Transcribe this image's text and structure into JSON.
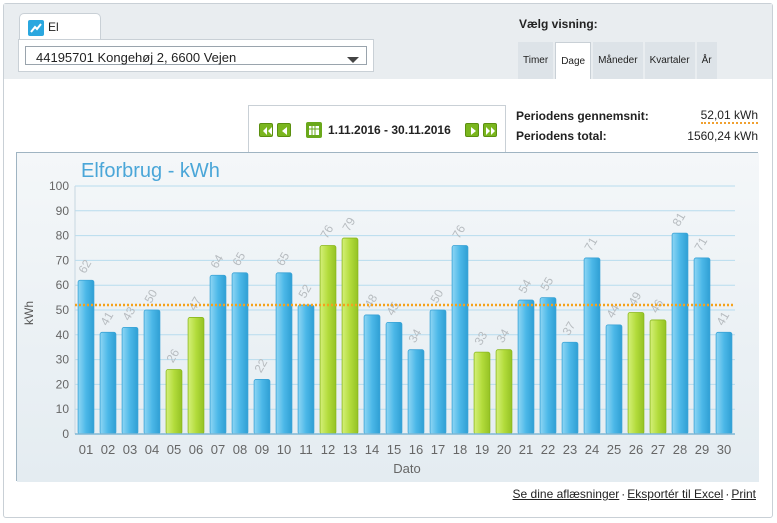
{
  "tab": {
    "label": "El",
    "icon": "electricity-icon"
  },
  "meter": {
    "selected": "44195701 Kongehøj 2, 6600 Vejen"
  },
  "view": {
    "label": "Vælg visning:",
    "options": [
      "Timer",
      "Dage",
      "Måneder",
      "Kvartaler",
      "År"
    ],
    "active": "Dage"
  },
  "period": {
    "range": "1.11.2016 - 30.11.2016"
  },
  "stats": {
    "avg_label": "Periodens gennemsnit:",
    "avg_value": "52,01 kWh",
    "total_label": "Periodens total:",
    "total_value": "1560,24 kWh"
  },
  "chart_data": {
    "type": "bar",
    "title": "Elforbrug - kWh",
    "xlabel": "Dato",
    "ylabel": "kWh",
    "ylim": [
      0,
      100
    ],
    "yticks": [
      0,
      10,
      20,
      30,
      40,
      50,
      60,
      70,
      80,
      90,
      100
    ],
    "average": 52.01,
    "grid": true,
    "categories": [
      "01",
      "02",
      "03",
      "04",
      "05",
      "06",
      "07",
      "08",
      "09",
      "10",
      "11",
      "12",
      "13",
      "14",
      "15",
      "16",
      "17",
      "18",
      "19",
      "20",
      "21",
      "22",
      "23",
      "24",
      "25",
      "26",
      "27",
      "28",
      "29",
      "30"
    ],
    "values": [
      62,
      41,
      43,
      50,
      26,
      47,
      64,
      65,
      22,
      65,
      52,
      76,
      79,
      48,
      45,
      34,
      50,
      76,
      33,
      34,
      54,
      55,
      37,
      71,
      44,
      49,
      46,
      81,
      71,
      41
    ],
    "weekend": [
      false,
      false,
      false,
      false,
      true,
      true,
      false,
      false,
      false,
      false,
      false,
      true,
      true,
      false,
      false,
      false,
      false,
      false,
      true,
      true,
      false,
      false,
      false,
      false,
      false,
      true,
      true,
      false,
      false,
      false
    ],
    "colors": {
      "weekday": "#5bc0ea",
      "weekend": "#b8e04a",
      "average": "#f5a21c",
      "title": "#4aa6d8"
    }
  },
  "links": {
    "readings": "Se dine aflæsninger",
    "export": "Eksportér til Excel",
    "print": "Print"
  }
}
